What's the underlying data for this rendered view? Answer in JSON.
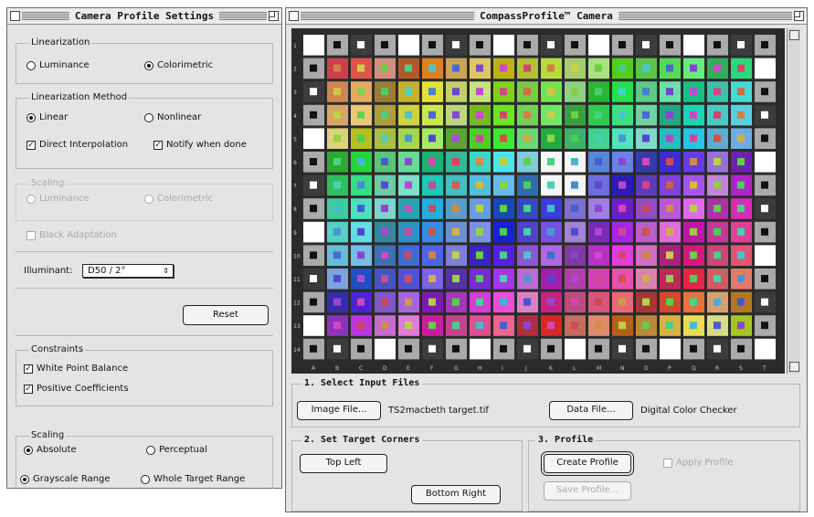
{
  "left_window": {
    "title": "Camera Profile Settings",
    "linearization": {
      "label": "Linearization",
      "options": [
        "Luminance",
        "Colorimetric"
      ],
      "selected": "Colorimetric"
    },
    "linearization_method": {
      "label": "Linearization Method",
      "options": [
        "Linear",
        "Nonlinear"
      ],
      "selected": "Linear"
    },
    "checks": {
      "direct_interpolation": "Direct Interpolation",
      "notify_when_done": "Notify when done"
    },
    "scaling_disabled": {
      "label": "Scaling",
      "options": [
        "Luminance",
        "Colorimetric"
      ]
    },
    "black_adaptation": "Black Adaptation",
    "illuminant": {
      "label": "Illuminant:",
      "value": "D50 / 2°"
    },
    "reset": "Reset",
    "constraints": {
      "label": "Constraints",
      "white_point_balance": "White Point Balance",
      "positive_coefficients": "Positive Coefficients"
    },
    "scaling": {
      "label": "Scaling",
      "options": [
        "Absolute",
        "Perceptual",
        "Grayscale Range",
        "Whole Target Range"
      ],
      "selected": [
        "Absolute",
        "Grayscale Range"
      ]
    }
  },
  "right_window": {
    "title": "CompassProfile™ Camera",
    "section1": {
      "label": "1. Select Input Files",
      "image_button": "Image File...",
      "image_value": "TS2macbeth target.tif",
      "data_button": "Data File...",
      "data_value": "Digital Color Checker"
    },
    "section2": {
      "label": "2. Set Target Corners",
      "top_left": "Top Left",
      "bottom_right": "Bottom Right"
    },
    "section3": {
      "label": "3. Profile",
      "create": "Create Profile",
      "save": "Save Profile...",
      "apply": "Apply Profile"
    },
    "row_labels": [
      "1",
      "2",
      "3",
      "4",
      "5",
      "6",
      "7",
      "8",
      "9",
      "10",
      "11",
      "12",
      "13",
      "14"
    ],
    "col_labels": [
      "A",
      "B",
      "C",
      "D",
      "E",
      "F",
      "G",
      "H",
      "I",
      "J",
      "K",
      "L",
      "M",
      "N",
      "O",
      "P",
      "Q",
      "R",
      "S",
      "T"
    ]
  }
}
